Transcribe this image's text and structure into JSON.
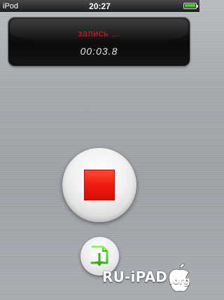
{
  "status_bar": {
    "device": "iPod",
    "time": "20:27",
    "battery_level": 1.0
  },
  "display": {
    "status": "запись ...",
    "timer": "00:03.8",
    "status_color": "#e01b1b"
  },
  "controls": {
    "stop_icon": "stop-icon",
    "export_icon": "export-icon",
    "stop_color": "#ee1a10",
    "export_color": "#5bd12b"
  },
  "watermark": {
    "text": "RU-iPAD",
    "suffix": ".org"
  }
}
